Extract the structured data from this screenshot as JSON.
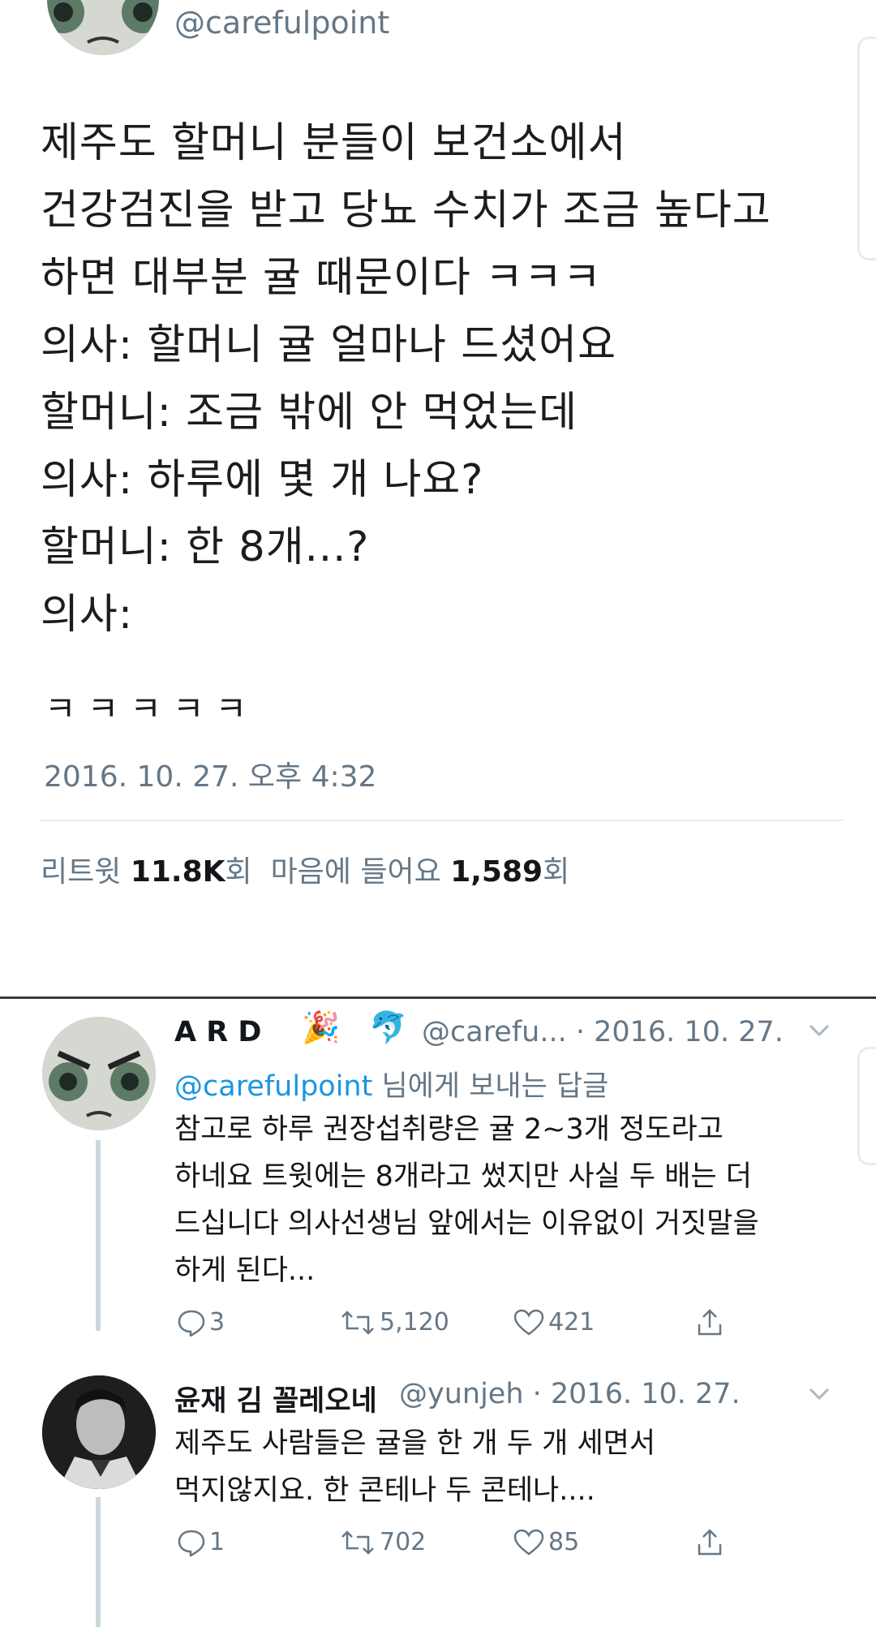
{
  "main_tweet": {
    "handle": "@carefulpoint",
    "body": "제주도 할머니 분들이 보건소에서\n건강검진을 받고 당뇨 수치가 조금 높다고\n하면 대부분 귤 때문이다 ㅋㅋㅋ\n의사: 할머니 귤 얼마나 드셨어요\n할머니: 조금 밖에 안 먹었는데\n의사: 하루에 몇 개 나요?\n할머니: 한 8개...?\n의사:",
    "laugh": "ㅋㅋㅋㅋㅋ",
    "timestamp": "2016. 10. 27. 오후 4:32",
    "stats": {
      "retweet_label": "리트윗",
      "retweet_count": "11.8K",
      "retweet_unit": "회",
      "like_label": "마음에 들어요",
      "like_count": "1,589",
      "like_unit": "회"
    }
  },
  "replies": [
    {
      "name": "A R D",
      "handle_date": "@carefu... · 2016. 10. 27.",
      "reply_to_handle": "@carefulpoint",
      "reply_to_suffix": " 님에게 보내는 답글",
      "text": "참고로 하루 권장섭취량은 귤 2~3개 정도라고\n하네요 트윗에는 8개라고 썼지만 사실 두 배는 더\n드십니다 의사선생님 앞에서는 이유없이 거짓말을\n하게 된다...",
      "replies": "3",
      "retweets": "5,120",
      "likes": "421"
    },
    {
      "name": "윤재 김 꼴레오네",
      "handle_date": "@yunjeh · 2016. 10. 27.",
      "text": "제주도 사람들은 귤을 한 개 두 개 세면서\n먹지않지요. 한 콘테나 두 콘테나....",
      "replies": "1",
      "retweets": "702",
      "likes": "85"
    }
  ]
}
